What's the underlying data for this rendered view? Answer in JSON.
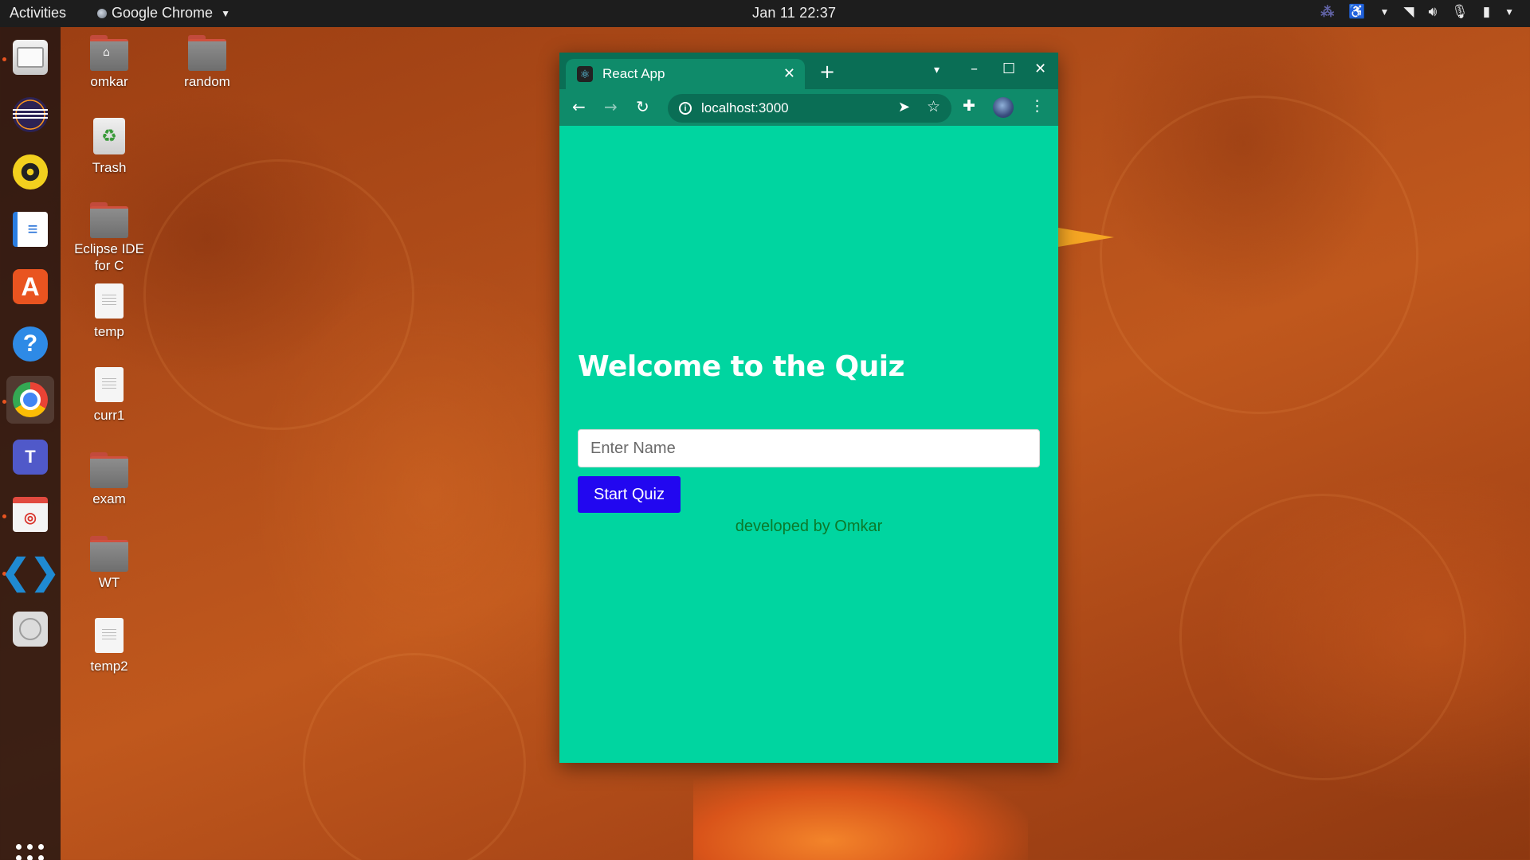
{
  "topbar": {
    "activities": "Activities",
    "app_name": "Google Chrome",
    "clock": "Jan 11  22:37"
  },
  "dock": {
    "items": [
      {
        "name": "files",
        "icon": "files-icon"
      },
      {
        "name": "eclipse",
        "icon": "eclipse-icon"
      },
      {
        "name": "rhythmbox",
        "icon": "rhythmbox-icon"
      },
      {
        "name": "libreoffice-writer",
        "icon": "writer-icon"
      },
      {
        "name": "software-center",
        "icon": "software-icon"
      },
      {
        "name": "help",
        "icon": "help-icon"
      },
      {
        "name": "chrome",
        "icon": "chrome-icon"
      },
      {
        "name": "teams",
        "icon": "teams-icon"
      },
      {
        "name": "document-viewer",
        "icon": "document-viewer-icon"
      },
      {
        "name": "vscode",
        "icon": "vscode-icon"
      },
      {
        "name": "disc",
        "icon": "disc-icon"
      }
    ]
  },
  "desktop": {
    "icons": [
      {
        "label": "omkar",
        "type": "home-folder"
      },
      {
        "label": "random",
        "type": "folder"
      },
      {
        "label": "Trash",
        "type": "trash"
      },
      {
        "label": "Eclipse IDE for C",
        "type": "folder"
      },
      {
        "label": "temp",
        "type": "document"
      },
      {
        "label": "curr1",
        "type": "document"
      },
      {
        "label": "exam",
        "type": "folder"
      },
      {
        "label": "WT",
        "type": "folder"
      },
      {
        "label": "temp2",
        "type": "document"
      }
    ]
  },
  "browser": {
    "tab_title": "React App",
    "url": "localhost:3000",
    "theme_color": "#0f8b6a"
  },
  "page": {
    "background": "#00d5a0",
    "heading": "Welcome to the Quiz",
    "name_placeholder": "Enter Name",
    "name_value": "",
    "start_button": "Start Quiz",
    "button_color": "#2207f0",
    "credit": "developed by Omkar"
  }
}
